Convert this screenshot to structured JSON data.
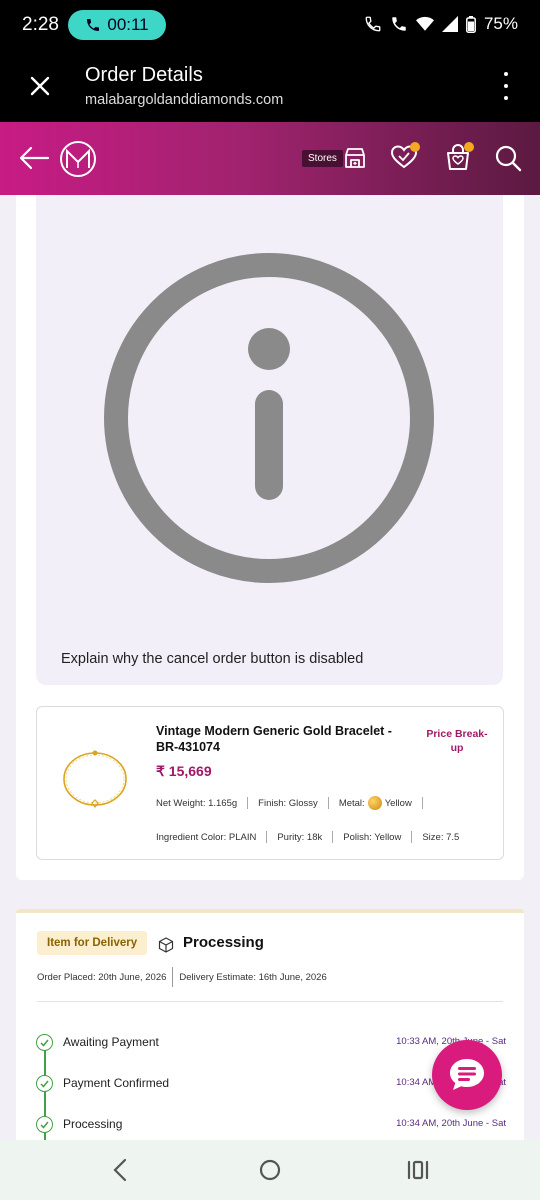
{
  "status_bar": {
    "time": "2:28",
    "call_timer": "00:11",
    "battery": "75%"
  },
  "browser": {
    "title": "Order Details",
    "url": "malabargoldanddiamonds.com"
  },
  "header": {
    "stores_label": "Stores"
  },
  "info_panel": {
    "message": "Explain why the cancel order button is disabled"
  },
  "product": {
    "name": "Vintage Modern Generic Gold Bracelet - BR-431074",
    "price": "₹ 15,669",
    "price_breakup_label": "Price Break-up",
    "net_weight": "Net Weight: 1.165g",
    "finish": "Finish: Glossy",
    "metal_label": "Metal:",
    "metal_value": "Yellow",
    "ingredient_color": "Ingredient Color: PLAIN",
    "purity": "Purity: 18k",
    "polish": "Polish: Yellow",
    "size": "Size: 7.5"
  },
  "order_status": {
    "badge": "Item for Delivery",
    "status": "Processing",
    "order_placed": "Order Placed: 20th June, 2026",
    "delivery_estimate": "Delivery Estimate: 16th June, 2026",
    "steps": [
      {
        "label": "Awaiting Payment",
        "time": "10:33 AM, 20th June - Sat"
      },
      {
        "label": "Payment Confirmed",
        "time": "10:34 AM, 20th June - Sat"
      },
      {
        "label": "Processing",
        "time": "10:34 AM, 20th June - Sat"
      }
    ]
  },
  "colors": {
    "brand": "#c81b85",
    "brand_dark": "#5b1a41",
    "accent_price": "#a11867",
    "success": "#43a047",
    "fab": "#d81b7c"
  },
  "icons": [
    "phone-icon",
    "close-icon",
    "kebab-menu-icon",
    "back-arrow-icon",
    "brand-logo",
    "store-icon",
    "wishlist-heart-icon",
    "cart-bag-icon",
    "search-icon",
    "info-icon",
    "cube-icon",
    "check-icon",
    "chat-icon",
    "nav-back-icon",
    "nav-home-icon",
    "nav-recents-icon"
  ]
}
